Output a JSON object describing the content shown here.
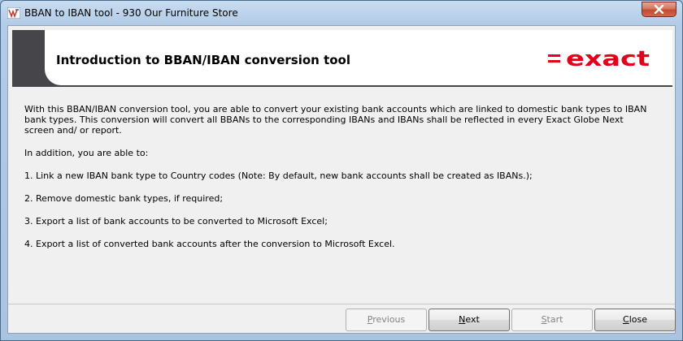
{
  "window": {
    "title": "BBAN to IBAN tool - 930 Our Furniture Store"
  },
  "header": {
    "title": "Introduction to BBAN/IBAN conversion tool",
    "logo_text": "= exact",
    "logo_color": "#e2001a"
  },
  "content": {
    "intro": "With this BBAN/IBAN conversion tool, you are able to convert your existing bank accounts which are linked to domestic bank types to IBAN bank types. This conversion will convert all BBANs to the corresponding IBANs and IBANs shall be reflected in every Exact Globe Next screen and/ or report.",
    "addition": "In addition, you are able to:",
    "items": [
      "1. Link a new IBAN bank type to Country codes (Note: By default, new bank accounts shall be created as IBANs.);",
      "2. Remove domestic bank types, if required;",
      "3. Export a list of bank accounts to be converted to Microsoft Excel;",
      "4. Export a list of converted bank accounts after the conversion to Microsoft Excel."
    ]
  },
  "buttons": {
    "previous": {
      "first": "P",
      "rest": "revious",
      "enabled": false
    },
    "next": {
      "first": "N",
      "rest": "ext",
      "enabled": true
    },
    "start": {
      "first": "S",
      "rest": "tart",
      "enabled": false
    },
    "close": {
      "first": "C",
      "rest": "lose",
      "enabled": true
    }
  },
  "icons": {
    "app": "bban-iban-tool-icon",
    "close": "close-icon"
  }
}
